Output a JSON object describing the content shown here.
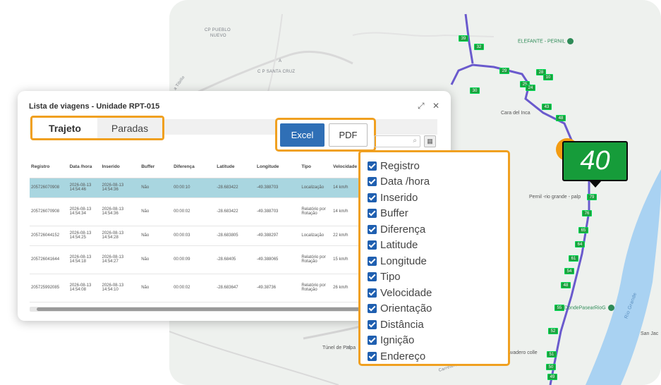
{
  "map": {
    "labels": {
      "cp_pueblo_nuevo_1": "CP PUEBLO",
      "cp_pueblo_nuevo_2": "NUEVO",
      "place_a": "A",
      "cp_santa_cruz": "C P SANTA CRUZ",
      "road_tibillo": "a Tibillo",
      "elefante": "ELEFANTE - PERNIL",
      "cara_del_inca": "Cara del Inca",
      "pernil": "Pernil -rio grande - palp",
      "donde_pasear": "DondePasearRioG",
      "rio_grande": "Rio Grande",
      "tunel": "Túnel de Palpa",
      "san_jac": "San Jac",
      "miradoro": "avadero colle",
      "panamericana": "Carretera Panamericana Sur",
      "road_1s": "1S"
    },
    "speed": "40",
    "route_markers": [
      "79",
      "76",
      "65",
      "64",
      "61",
      "54",
      "48",
      "55",
      "52",
      "51",
      "50",
      "49",
      "48",
      "43",
      "39",
      "32",
      "30",
      "29",
      "28",
      "25",
      "24",
      "10"
    ]
  },
  "panel": {
    "title": "Lista de viagens - Unidade RPT-015",
    "tabs": [
      "Trajeto",
      "Paradas"
    ],
    "export": {
      "excel": "Excel",
      "pdf": "PDF"
    },
    "headers": [
      "Registro",
      "Data /hora",
      "Inserido",
      "Buffer",
      "Diferença",
      "Latitude",
      "Longitude",
      "Tipo",
      "Velocidade"
    ],
    "rows": [
      {
        "registro": "205726070908",
        "data": "2026-08-13 14:54:46",
        "inserido": "2026-08-13 14:54:36",
        "buffer": "Não",
        "diferenca": "00:00:10",
        "lat": "-28.683422",
        "lon": "-49.388703",
        "tipo": "Localização",
        "vel": "14 km/h"
      },
      {
        "registro": "205726070908",
        "data": "2026-08-13 14:54:34",
        "inserido": "2026-08-13 14:54:36",
        "buffer": "Não",
        "diferenca": "00:00:02",
        "lat": "-28.683422",
        "lon": "-49.388703",
        "tipo": "Relatório por Rotação",
        "vel": "14 km/h"
      },
      {
        "registro": "205726044152",
        "data": "2026-08-13 14:54:25",
        "inserido": "2026-08-13 14:54:28",
        "buffer": "Não",
        "diferenca": "00:00:03",
        "lat": "-28.683805",
        "lon": "-49.388297",
        "tipo": "Localização",
        "vel": "22 km/h"
      },
      {
        "registro": "205726041644",
        "data": "2026-08-13 14:54:18",
        "inserido": "2026-08-13 14:54:27",
        "buffer": "Não",
        "diferenca": "00:00:09",
        "lat": "-28.68405",
        "lon": "-49.388065",
        "tipo": "Relatório por Rotação",
        "vel": "15 km/h"
      },
      {
        "registro": "205725992085",
        "data": "2026-08-13 14:54:08",
        "inserido": "2026-08-13 14:54:10",
        "buffer": "Não",
        "diferenca": "00:00:02",
        "lat": "-28.683647",
        "lon": "-49.38736",
        "tipo": "Relatório por Rotação",
        "vel": "26 km/h"
      }
    ]
  },
  "columns": [
    "Registro",
    "Data /hora",
    "Inserido",
    "Buffer",
    "Diferença",
    "Latitude",
    "Longitude",
    "Tipo",
    "Velocidade",
    "Orientação",
    "Distância",
    "Ignição",
    "Endereço"
  ]
}
